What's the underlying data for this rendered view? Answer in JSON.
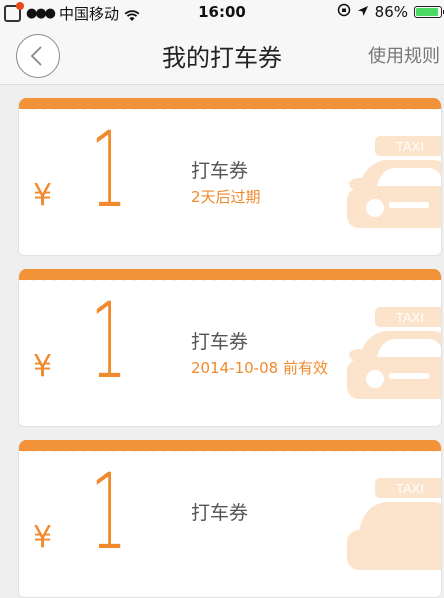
{
  "status_bar": {
    "carrier": "中国移动",
    "signal": "●●●",
    "time": "16:00",
    "battery": "86%"
  },
  "nav": {
    "title": "我的打车券",
    "rules": "使用规则"
  },
  "coupons": [
    {
      "currency": "¥",
      "amount": "1",
      "title": "打车券",
      "validity": "2天后过期"
    },
    {
      "currency": "¥",
      "amount": "1",
      "title": "打车券",
      "validity": "2014-10-08 前有效"
    },
    {
      "currency": "¥",
      "amount": "1",
      "title": "打车券",
      "validity": ""
    }
  ],
  "colors": {
    "accent": "#f39339",
    "text_accent": "#f08a2c",
    "taxi_watermark": "#fbe3cc"
  },
  "icons": {
    "back": "chevron-left-icon",
    "taxi": "taxi-icon",
    "wifi": "wifi-icon",
    "battery": "battery-icon"
  }
}
